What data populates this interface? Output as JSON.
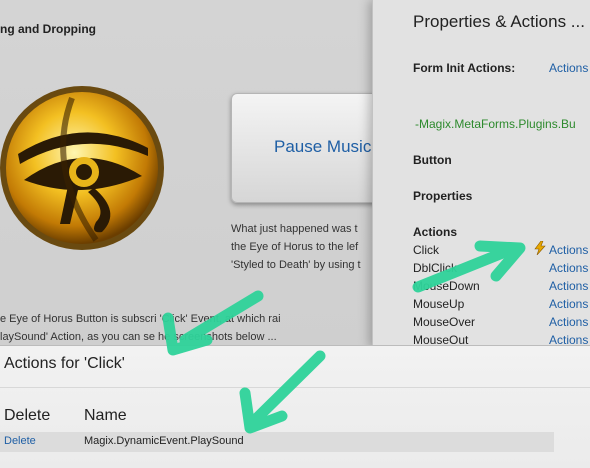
{
  "background": {
    "title": "ng and Dropping",
    "pause_button": "Pause Music",
    "paragraph_right": [
      "What just happened was t",
      "the Eye of Horus to the lef",
      "'Styled to Death' by using t"
    ],
    "paragraph_left": [
      "e Eye of Horus Button is subscri                'Click' Event, at which rai",
      "laySound' Action, as you can se              he screenshots below ..."
    ]
  },
  "properties": {
    "title": "Properties & Actions ...",
    "form_init_label": "Form Init Actions:",
    "form_init_link": "Actions",
    "plugin_text": "-Magix.MetaForms.Plugins.Bu",
    "button_heading": "Button",
    "properties_heading": "Properties",
    "actions_heading": "Actions",
    "events": [
      {
        "name": "Click",
        "link": "Actions"
      },
      {
        "name": "DblClick",
        "link": "Actions"
      },
      {
        "name": "MouseDown",
        "link": "Actions"
      },
      {
        "name": "MouseUp",
        "link": "Actions"
      },
      {
        "name": "MouseOver",
        "link": "Actions"
      },
      {
        "name": "MouseOut",
        "link": "Actions"
      }
    ]
  },
  "dialog": {
    "title": "Actions for 'Click'",
    "columns": [
      "Delete",
      "Name"
    ],
    "rows": [
      {
        "delete": "Delete",
        "name": "Magix.DynamicEvent.PlaySound"
      }
    ]
  },
  "colors": {
    "link": "#1f5fa5",
    "plugin_green": "#2d8a2d",
    "arrow": "#2fd39a"
  }
}
